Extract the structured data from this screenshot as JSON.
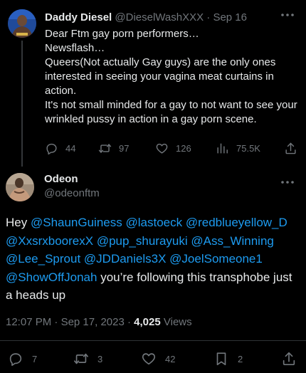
{
  "parent_tweet": {
    "name": "Daddy Diesel",
    "handle": "@DieselWashXXX",
    "separator": "·",
    "time": "Sep 16",
    "lines": [
      "Dear Ftm gay porn performers…",
      "Newsflash…",
      "Queers(Not actually Gay guys) are the only ones interested in seeing your vagina meat curtains in action.",
      "It's not small minded for a gay to not want to see your wrinkled pussy in action in a gay porn scene."
    ],
    "replies": "44",
    "reposts": "97",
    "likes": "126",
    "views": "75.5K"
  },
  "main_tweet": {
    "name": "Odeon",
    "handle": "@odeonftm",
    "text": {
      "hey": "Hey ",
      "sp": " ",
      "mentions": [
        "@ShaunGuiness",
        "@lastoeck",
        "@redblueyellow_D",
        "@XxsrxboorexX",
        "@pup_shurayuki",
        "@Ass_Winning",
        "@Lee_Sprout",
        "@JDDaniels3X",
        "@JoelSomeone1",
        "@ShowOffJonah"
      ],
      "tail": " you’re following this transphobe just a heads up"
    },
    "time": "12:07 PM",
    "separator": "·",
    "date": "Sep 17, 2023",
    "views_count": "4,025",
    "views_label": "Views",
    "replies": "7",
    "reposts": "3",
    "likes": "42",
    "bookmarks": "2"
  },
  "icons": {
    "reply": "reply-icon",
    "repost": "repost-icon",
    "like": "heart-icon",
    "views": "analytics-icon",
    "bookmark": "bookmark-icon",
    "share": "share-icon",
    "more": "more-icon"
  },
  "colors": {
    "background": "#000000",
    "text": "#e7e9ea",
    "secondary": "#71767b",
    "link": "#1d9bf0",
    "divider": "#2f3336"
  }
}
